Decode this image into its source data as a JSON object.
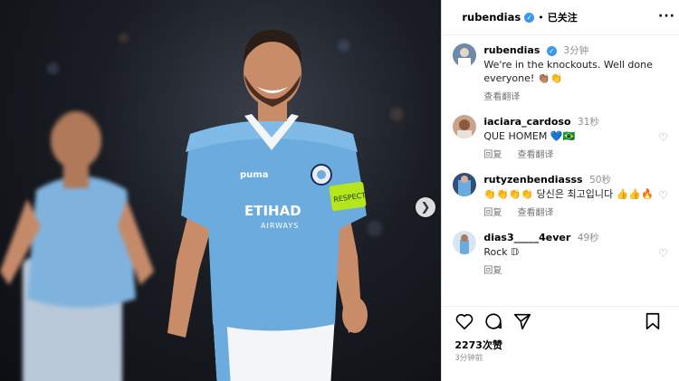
{
  "header": {
    "username": "rubendias",
    "separator": "•",
    "follow_label": "已关注",
    "more_label": "···"
  },
  "photo": {
    "jersey_sponsor_main": "ETIHAD",
    "jersey_sponsor_sub": "AIRWAYS",
    "armband_text": "RESPECT",
    "kit_brand": "puma"
  },
  "caption": {
    "username": "rubendias",
    "time": "3分钟",
    "text": "We're in the knockouts. Well done everyone! 👏🏽👏",
    "translate_label": "查看翻译"
  },
  "comments": [
    {
      "username": "iaciara_cardoso",
      "time": "31秒",
      "text": "QUE HOMEM 💙🇧🇷",
      "reply_label": "回复",
      "translate_label": "查看翻译"
    },
    {
      "username": "rutyzenbendiasss",
      "time": "50秒",
      "text": "👏👏👏👏 당신은 최고입니다 👍👍🔥",
      "reply_label": "回复",
      "translate_label": "查看翻译"
    },
    {
      "username": "dias3_____4ever",
      "time": "49秒",
      "text": "Rock 𝔻",
      "reply_label": "回复"
    }
  ],
  "footer": {
    "likes": "2273次赞",
    "time": "3分钟前"
  },
  "colors": {
    "verified": "#3897f0",
    "jersey": "#6cabdd",
    "armband": "#b5e61d",
    "muted_text": "#8e8e8e"
  },
  "icons": [
    "verified-badge-icon",
    "more-icon",
    "heart-icon",
    "comment-icon",
    "share-icon",
    "bookmark-icon",
    "chevron-right-icon"
  ]
}
